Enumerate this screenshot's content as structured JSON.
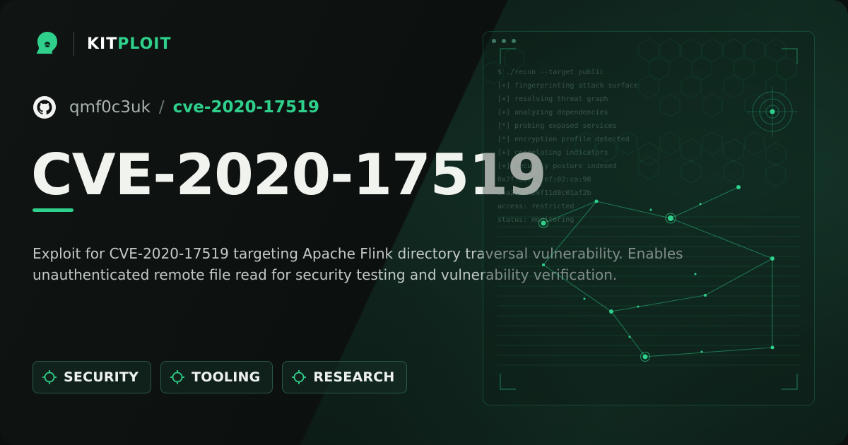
{
  "brand": {
    "name_part1": "KIT",
    "name_part2": "PLOIT",
    "logo_icon": "kitploit-head-icon"
  },
  "repo": {
    "owner": "qmf0c3uk",
    "separator": "/",
    "name": "cve-2020-17519",
    "icon": "github-icon"
  },
  "title": "CVE-2020-17519",
  "description": "Exploit for CVE-2020-17519 targeting Apache Flink directory traversal vulnerability. Enables unauthenticated remote file read for security testing and vulnerability verification.",
  "tags": [
    {
      "label": "SECURITY",
      "icon": "crosshair-icon"
    },
    {
      "label": "TOOLING",
      "icon": "crosshair-icon"
    },
    {
      "label": "RESEARCH",
      "icon": "crosshair-icon"
    }
  ],
  "terminal": {
    "lines": [
      "$ ./recon --target public",
      "[+] fingerprinting attack surface",
      "[+] resolving threat graph",
      "[+] analyzing dependencies",
      "[*] probing exposed services",
      "[*] encryption profile detected",
      "[+] correlating indicators",
      "[+] security posture indexed",
      "0x7f:3c:22:ef:02:ca:98",
      "sha256:4e9f11d8c01af2b",
      "access: restricted",
      "status: monitoring"
    ]
  },
  "colors": {
    "accent": "#2fd08c",
    "background": "#0b0f0d",
    "title": "#f1f3ef"
  }
}
